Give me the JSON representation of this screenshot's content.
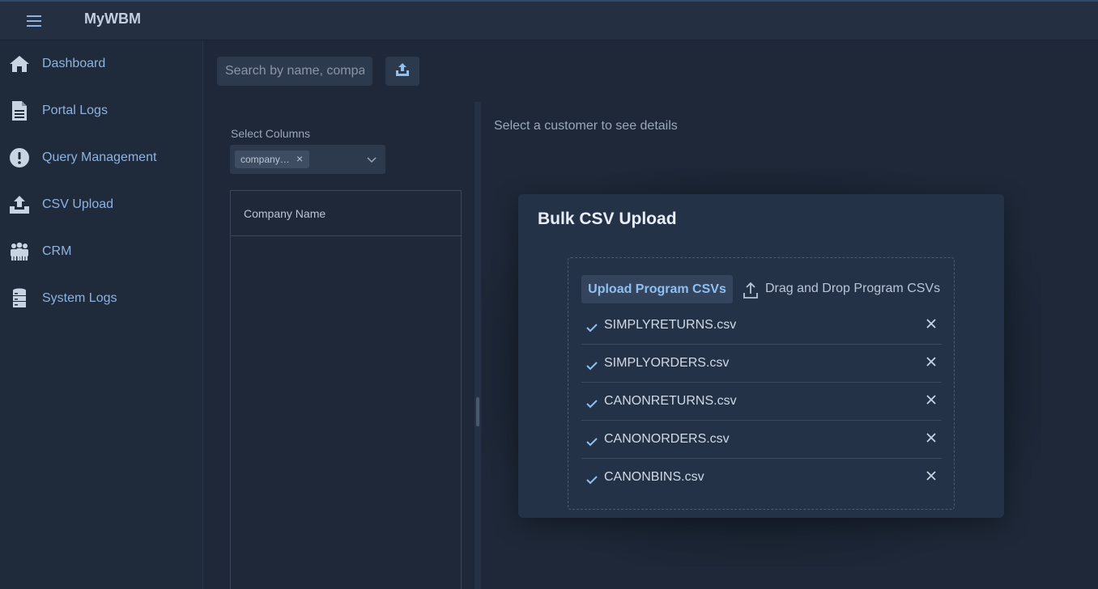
{
  "header": {
    "app_title": "MyWBM",
    "menu_icon": "hamburger-menu-icon"
  },
  "sidebar": {
    "items": [
      {
        "label": "Dashboard",
        "icon": "home-icon"
      },
      {
        "label": "Portal Logs",
        "icon": "document-icon"
      },
      {
        "label": "Query Management",
        "icon": "exclamation-circle-icon"
      },
      {
        "label": "CSV Upload",
        "icon": "upload-icon"
      },
      {
        "label": "CRM",
        "icon": "users-icon"
      },
      {
        "label": "System Logs",
        "icon": "server-icon"
      }
    ]
  },
  "toolbar": {
    "search_placeholder": "Search by name, company",
    "upload_icon": "upload-icon"
  },
  "columns": {
    "label": "Select Columns",
    "selected_chip": "company…",
    "chip_remove": "×"
  },
  "table": {
    "headers": [
      "Company Name"
    ]
  },
  "detail": {
    "hint": "Select a customer to see details"
  },
  "modal": {
    "title": "Bulk CSV Upload",
    "upload_button": "Upload Program CSVs",
    "drag_drop_label": "Drag and Drop Program CSVs",
    "files": [
      {
        "name": "SIMPLYRETURNS.csv"
      },
      {
        "name": "SIMPLYORDERS.csv"
      },
      {
        "name": "CANONRETURNS.csv"
      },
      {
        "name": "CANONORDERS.csv"
      },
      {
        "name": "CANONBINS.csv"
      }
    ]
  },
  "colors": {
    "accent": "#8fc0f2",
    "nav_text": "#8fb3e0",
    "background": "#1e2838",
    "modal_bg": "#243248"
  }
}
